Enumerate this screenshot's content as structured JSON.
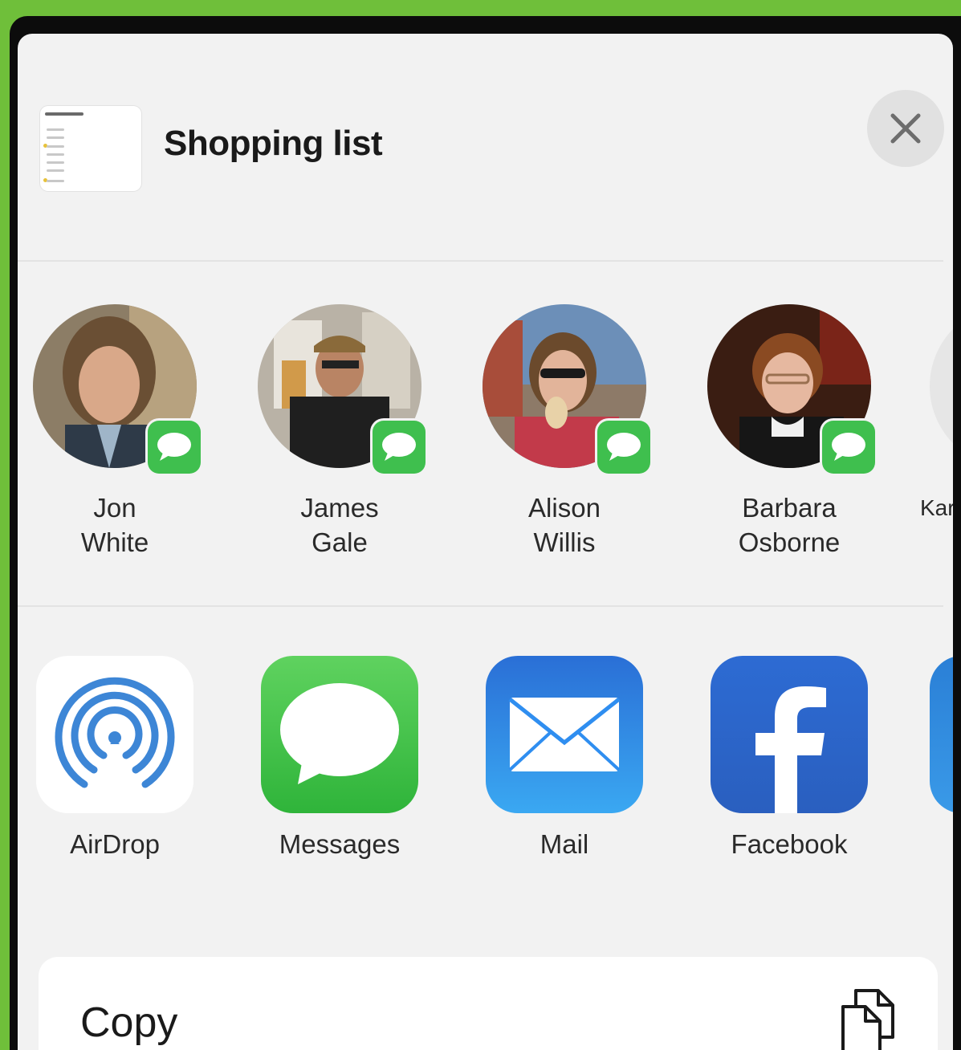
{
  "sheet": {
    "title": "Shopping list",
    "close_label": "close"
  },
  "contacts": [
    {
      "first": "Jon",
      "last": "White"
    },
    {
      "first": "James",
      "last": "Gale"
    },
    {
      "first": "Alison",
      "last": "Willis"
    },
    {
      "first": "Barbara",
      "last": "Osborne"
    },
    {
      "first": "Karl",
      "last": ""
    }
  ],
  "apps": [
    {
      "label": "AirDrop",
      "icon": "airdrop-icon"
    },
    {
      "label": "Messages",
      "icon": "messages-icon"
    },
    {
      "label": "Mail",
      "icon": "mail-icon"
    },
    {
      "label": "Facebook",
      "icon": "facebook-icon"
    }
  ],
  "actions": {
    "copy_label": "Copy"
  },
  "colors": {
    "background_accent": "#6fbf3a",
    "sheet_bg": "#f2f2f2",
    "messages_green": "#3fbf4e",
    "mail_blue": "#2f8ef0",
    "facebook_blue": "#2d6bd3",
    "airdrop_blue": "#3d86d6"
  }
}
